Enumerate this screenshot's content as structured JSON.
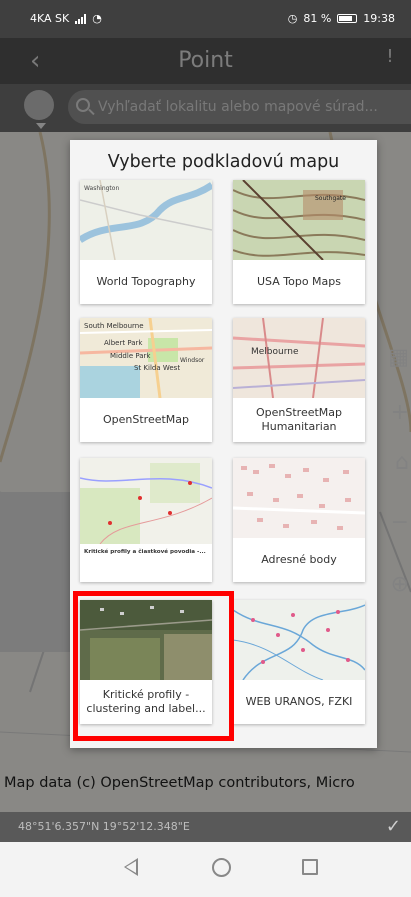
{
  "status_bar": {
    "carrier": "4KA SK",
    "battery": "81 %",
    "time": "19:38"
  },
  "header": {
    "title": "Point",
    "back_icon": "chevron-left-icon",
    "alert_icon": "alert-icon"
  },
  "search": {
    "placeholder": "Vyhľadať lokalitu alebo mapové súrad..."
  },
  "dialog": {
    "title": "Vyberte podkladovú mapu",
    "basemaps": [
      {
        "label": "World Topography"
      },
      {
        "label": "USA Topo Maps"
      },
      {
        "label": "OpenStreetMap"
      },
      {
        "label": "OpenStreetMap Humanitarian"
      },
      {
        "label": "Kritické profily a čiastkové povodia -..."
      },
      {
        "label": "Adresné body"
      },
      {
        "label": "Kritické profily - clustering and label..."
      },
      {
        "label": "WEB URANOS, FZKI"
      }
    ],
    "thumb_text": {
      "washington": "Washington",
      "southgate": "Southgate",
      "south_melbourne": "South Melbourne",
      "albert_park": "Albert Park",
      "middle_park": "Middle Park",
      "st_kilda_west": "St Kilda West",
      "windsor": "Windsor",
      "melbourne": "Melbourne"
    }
  },
  "map": {
    "attribution": "Map data (c) OpenStreetMap contributors, Micro"
  },
  "coordinates": {
    "value": "48°51'6.357\"N 19°52'12.348\"E"
  },
  "highlight_color": "#ff0000"
}
